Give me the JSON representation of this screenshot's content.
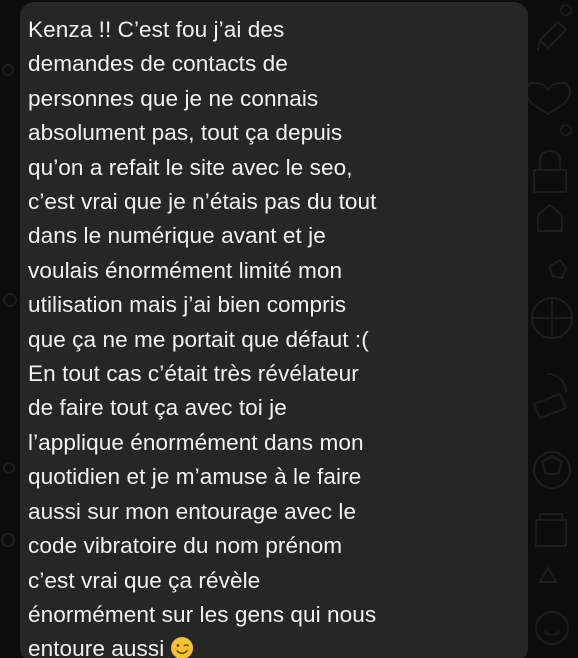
{
  "message": {
    "lines": [
      "Kenza !! C’est fou j’ai des",
      "demandes de contacts de",
      "personnes que je ne connais",
      "absolument pas, tout ça depuis",
      "qu’on a refait le site avec le seo,",
      "c’est vrai que je n’étais pas du tout",
      "dans le numérique avant et je",
      "voulais énormément limité mon",
      "utilisation mais j’ai bien compris",
      "que ça ne me portait que défaut :(",
      "En tout cas c’était très révélateur",
      "de faire tout ça avec toi je",
      "l’applique énormément dans mon",
      "quotidien et je m’amuse à le faire",
      "aussi sur mon entourage avec le",
      "code vibratoire du nom prénom",
      "c’est vrai que ça révèle",
      "énormément sur les gens qui nous",
      "entoure aussi"
    ],
    "emoji": "winking-face-icon"
  },
  "colors": {
    "background": "#0c0c0c",
    "bubble": "#262627",
    "text": "#f1f1f1",
    "doodle_stroke": "#2b2b2b",
    "emoji_face": "#f7c325"
  }
}
